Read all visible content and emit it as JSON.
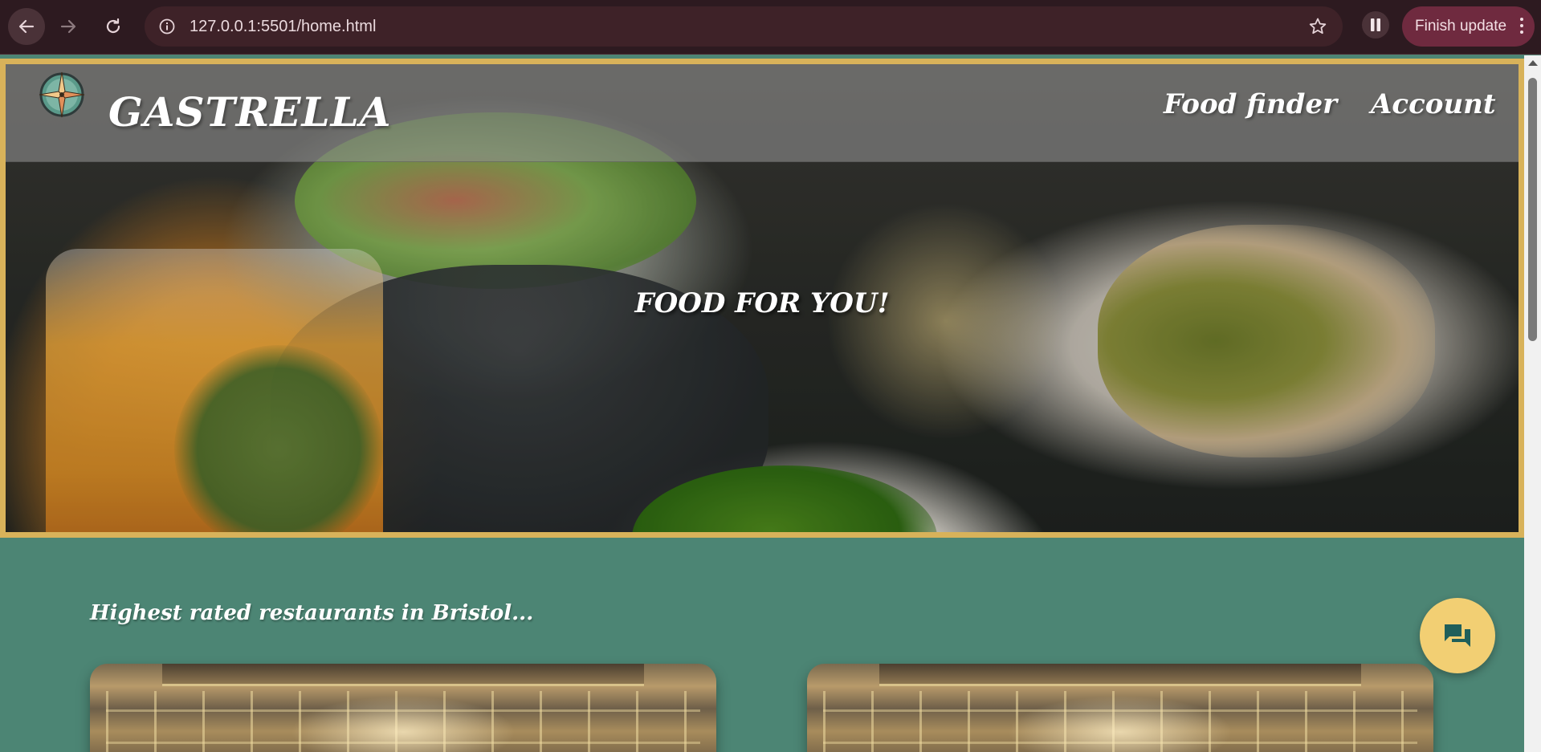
{
  "browser": {
    "url": "127.0.0.1:5501/home.html",
    "finish_update_label": "Finish update"
  },
  "navbar": {
    "brand": "GASTRELLA",
    "links": [
      "Food finder",
      "Account"
    ]
  },
  "hero": {
    "title": "FOOD FOR YOU!"
  },
  "section": {
    "title": "Highest rated restaurants in Bristol..."
  },
  "colors": {
    "page_background": "#4c8574",
    "hero_border": "#d8b25a",
    "chat_button": "#f2cf73",
    "chrome_background": "#2d1a20",
    "finish_update_button": "#6f2a3f"
  },
  "icons": {
    "back": "back-arrow-icon",
    "forward": "forward-arrow-icon",
    "reload": "reload-icon",
    "site_info": "info-icon",
    "bookmark": "star-icon",
    "pause": "pause-icon",
    "menu": "more-vertical-icon",
    "logo": "compass-logo-icon",
    "chat": "chat-icon"
  }
}
